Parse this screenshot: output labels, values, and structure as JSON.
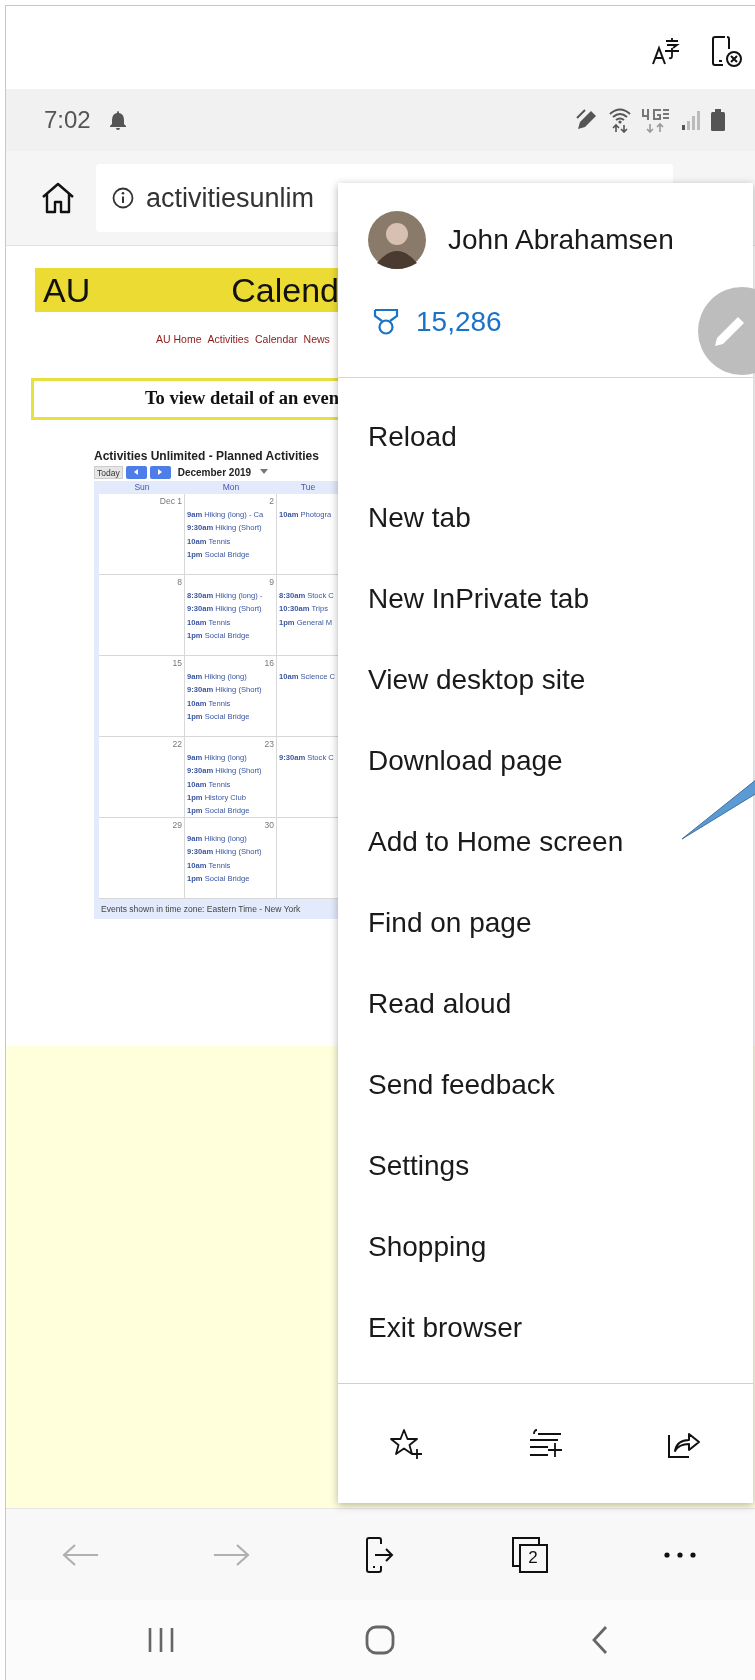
{
  "status_bar": {
    "time": "7:02"
  },
  "address_bar": {
    "url": "activitiesunlim"
  },
  "page": {
    "banner": [
      "AU",
      "Calend"
    ],
    "nav_links": [
      "AU Home",
      "Activities",
      "Calendar",
      "News"
    ],
    "notice": "To view detail of an even",
    "calendar": {
      "title": "Activities Unlimited - Planned Activities",
      "today_button": "Today",
      "month": "December 2019",
      "days": [
        "Sun",
        "Mon",
        "Tue"
      ],
      "weeks": [
        {
          "cells": [
            {
              "date": "Dec 1"
            },
            {
              "date": "2",
              "events": [
                {
                  "time": "9am",
                  "title": "Hiking (long) - Ca"
                },
                {
                  "time": "9:30am",
                  "title": "Hiking (Short)"
                },
                {
                  "time": "10am",
                  "title": "Tennis"
                },
                {
                  "time": "1pm",
                  "title": "Social Bridge"
                }
              ]
            },
            {
              "events": [
                {
                  "time": "10am",
                  "title": "Photogra"
                }
              ]
            }
          ]
        },
        {
          "cells": [
            {
              "date": "8"
            },
            {
              "date": "9",
              "events": [
                {
                  "time": "8:30am",
                  "title": "Hiking (long) -"
                },
                {
                  "time": "9:30am",
                  "title": "Hiking (Short)"
                },
                {
                  "time": "10am",
                  "title": "Tennis"
                },
                {
                  "time": "1pm",
                  "title": "Social Bridge"
                }
              ]
            },
            {
              "events": [
                {
                  "time": "8:30am",
                  "title": "Stock C"
                },
                {
                  "time": "10:30am",
                  "title": "Trips"
                },
                {
                  "time": "1pm",
                  "title": "General M"
                }
              ]
            }
          ]
        },
        {
          "cells": [
            {
              "date": "15"
            },
            {
              "date": "16",
              "events": [
                {
                  "time": "9am",
                  "title": "Hiking (long)"
                },
                {
                  "time": "9:30am",
                  "title": "Hiking (Short)"
                },
                {
                  "time": "10am",
                  "title": "Tennis"
                },
                {
                  "time": "1pm",
                  "title": "Social Bridge"
                }
              ]
            },
            {
              "events": [
                {
                  "time": "10am",
                  "title": "Science C"
                }
              ]
            }
          ]
        },
        {
          "cells": [
            {
              "date": "22"
            },
            {
              "date": "23",
              "events": [
                {
                  "time": "9am",
                  "title": "Hiking (long)"
                },
                {
                  "time": "9:30am",
                  "title": "Hiking (Short)"
                },
                {
                  "time": "10am",
                  "title": "Tennis"
                },
                {
                  "time": "1pm",
                  "title": "History Club"
                },
                {
                  "time": "1pm",
                  "title": "Social Bridge"
                }
              ]
            },
            {
              "events": [
                {
                  "time": "9:30am",
                  "title": "Stock C"
                }
              ]
            }
          ]
        },
        {
          "cells": [
            {
              "date": "29"
            },
            {
              "date": "30",
              "events": [
                {
                  "time": "9am",
                  "title": "Hiking (long)"
                },
                {
                  "time": "9:30am",
                  "title": "Hiking (Short)"
                },
                {
                  "time": "10am",
                  "title": "Tennis"
                },
                {
                  "time": "1pm",
                  "title": "Social Bridge"
                }
              ]
            },
            {}
          ]
        }
      ],
      "footer": "Events shown in time zone: Eastern Time - New York"
    }
  },
  "menu": {
    "profile": {
      "name": "John Abrahamsen",
      "points": "15,286"
    },
    "items": [
      "Reload",
      "New tab",
      "New InPrivate tab",
      "View desktop site",
      "Download page",
      "Add to Home screen",
      "Find on page",
      "Read aloud",
      "Send feedback",
      "Settings",
      "Shopping",
      "Exit browser"
    ]
  },
  "toolbar": {
    "buttons": [
      {
        "kind": "back",
        "disabled": true
      },
      {
        "kind": "forward",
        "disabled": true
      },
      {
        "kind": "send",
        "disabled": false
      },
      {
        "kind": "tabs",
        "disabled": false,
        "count": "2"
      },
      {
        "kind": "more",
        "disabled": false
      }
    ]
  }
}
